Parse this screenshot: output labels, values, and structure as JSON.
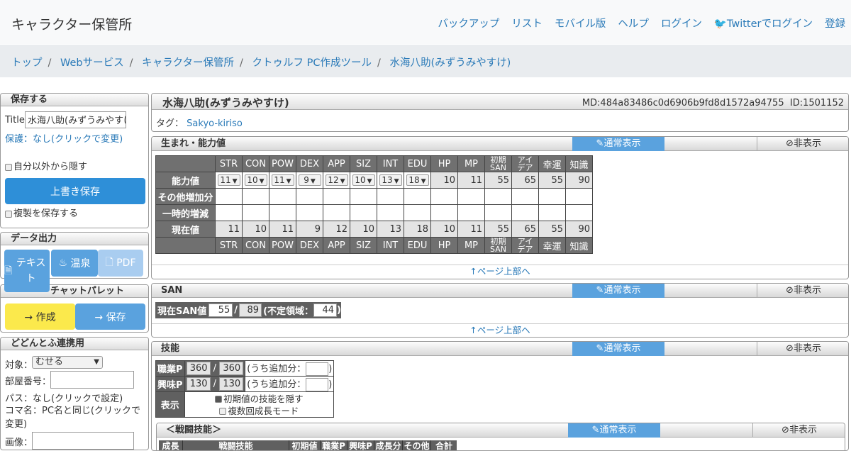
{
  "header": {
    "brand": "キャラクター保管所",
    "nav": [
      "バックアップ",
      "リスト",
      "モバイル版",
      "ヘルプ",
      "ログイン",
      "Twitterでログイン",
      "登録"
    ]
  },
  "breadcrumb": [
    "トップ",
    "Webサービス",
    "キャラクター保管所",
    "クトゥルフ PC作成ツール",
    "水海八助(みずうみやすけ)"
  ],
  "sidebar": {
    "save": {
      "title": "保存する",
      "title_label": "Title:",
      "title_value": "水海八助(みずうみやすけ)",
      "protect": "保護：なし(クリックで変更)",
      "hide_label": "自分以外から隠す",
      "overwrite": "上書き保存",
      "copy_label": "複製を保存する"
    },
    "output": {
      "title": "データ出力",
      "text_btn": "テキスト",
      "onsen_btn": "温泉",
      "pdf_btn": "PDF"
    },
    "chat": {
      "title": "チャットパレット",
      "create": "→ 作成",
      "save": "→ 保存"
    },
    "dodon": {
      "title": "どどんとふ連携用",
      "target_label": "対象：",
      "target_value": "むせる",
      "room_label": "部屋番号：",
      "pass": "パス：なし(クリックで設定)",
      "koma": "コマ名：PC名と同じ(クリックで変更)",
      "image_label": "画像："
    }
  },
  "character": {
    "name": "水海八助(みずうみやすけ)",
    "md": "MD:484a83486c0d6906b9fd8d1572a94755",
    "id": "ID:1501152",
    "tag_label": "タグ：",
    "tag": "Sakyo-kiriso"
  },
  "common": {
    "normal": "通常表示",
    "hide": "非表示",
    "pagetop": "↑ページ上部へ"
  },
  "abilities": {
    "title": "生まれ・能力値",
    "headers": [
      "STR",
      "CON",
      "POW",
      "DEX",
      "APP",
      "SIZ",
      "INT",
      "EDU",
      "HP",
      "MP",
      "初期SAN",
      "アイデア",
      "幸運",
      "知識"
    ],
    "header_lines": [
      [
        "STR"
      ],
      [
        "CON"
      ],
      [
        "POW"
      ],
      [
        "DEX"
      ],
      [
        "APP"
      ],
      [
        "SIZ"
      ],
      [
        "INT"
      ],
      [
        "EDU"
      ],
      [
        "HP"
      ],
      [
        "MP"
      ],
      [
        "初期",
        "SAN"
      ],
      [
        "アイ",
        "デア"
      ],
      [
        "幸運"
      ],
      [
        "知識"
      ]
    ],
    "row_labels": [
      "能力値",
      "その他増加分",
      "一時的増減",
      "現在値"
    ],
    "base": [
      "11",
      "10",
      "11",
      "9",
      "12",
      "10",
      "13",
      "18",
      "10",
      "11",
      "55",
      "65",
      "55",
      "90"
    ],
    "current": [
      "11",
      "10",
      "11",
      "9",
      "12",
      "10",
      "13",
      "18",
      "10",
      "11",
      "55",
      "65",
      "55",
      "90"
    ]
  },
  "san": {
    "title": "SAN",
    "label": "現在SAN値",
    "current": "55",
    "slash": "/",
    "max": "89",
    "undef_label": "(不定領域：",
    "undef": "44",
    "close": ")"
  },
  "skills": {
    "title": "技能",
    "job_label": "職業P",
    "job_value": "360",
    "job_total": "360",
    "hobby_label": "興味P",
    "hobby_value": "130",
    "hobby_total": "130",
    "extra_label": "(うち追加分：",
    "display_label": "表示",
    "hide_initial": "初期値の技能を隠す",
    "multi_growth": "複数回成長モード",
    "combat_title": "＜戦闘技能＞",
    "combat_cols": [
      "成長",
      "戦闘技能",
      "初期値",
      "職業P",
      "興味P",
      "成長分",
      "その他",
      "合計"
    ]
  }
}
